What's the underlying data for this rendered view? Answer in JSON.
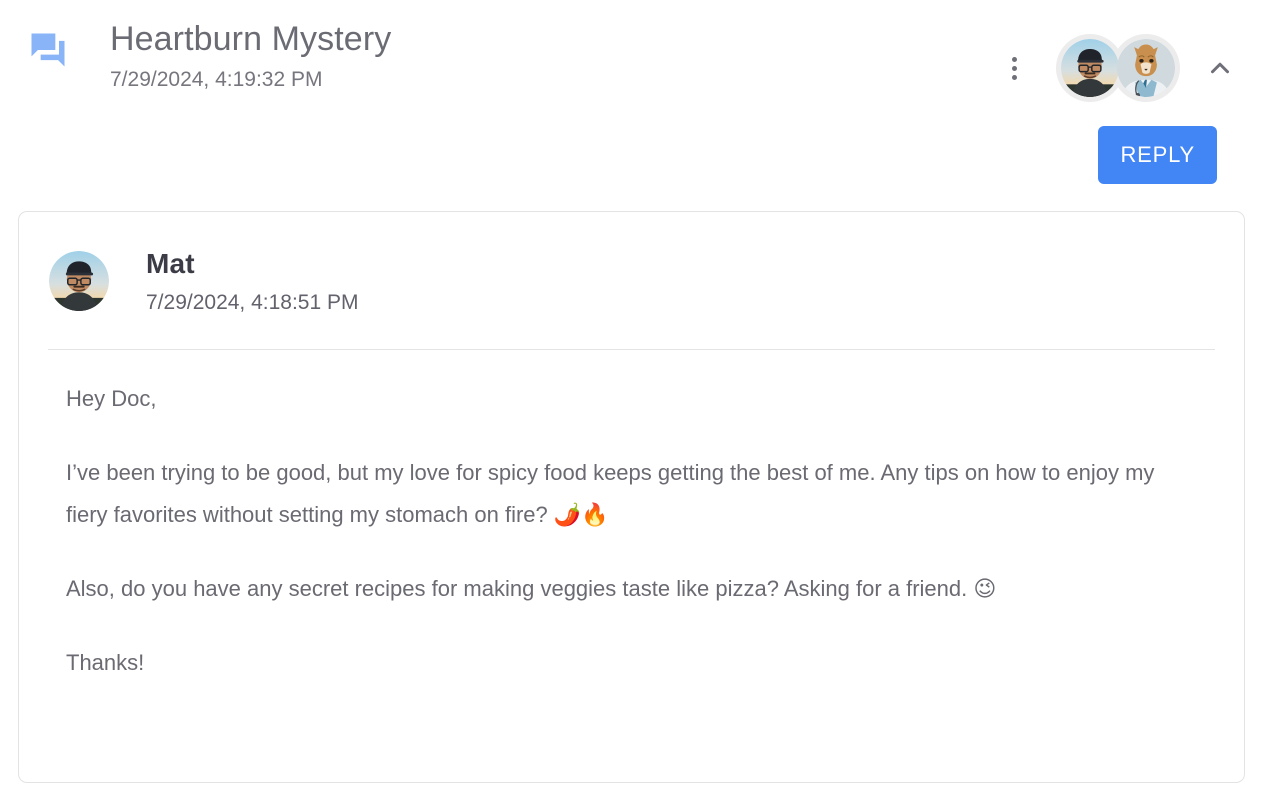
{
  "header": {
    "icon": "forum-icon",
    "icon_color": "#8ab4f8",
    "title": "Heartburn Mystery",
    "timestamp": "7/29/2024, 4:19:32 PM",
    "menu_icon": "more-vert-icon",
    "collapse_icon": "chevron-up-icon",
    "participants": [
      {
        "name": "Mat",
        "avatar": "person-cap-glasses-avatar"
      },
      {
        "name": "Doc",
        "avatar": "fox-doctor-avatar"
      }
    ]
  },
  "actions": {
    "reply_label": "REPLY",
    "reply_color": "#4285f4"
  },
  "message": {
    "author": "Mat",
    "avatar": "person-cap-glasses-avatar",
    "timestamp": "7/29/2024, 4:18:51 PM",
    "paragraphs": [
      "Hey Doc,",
      "I’ve been trying to be good, but my love for spicy food keeps getting the best of me. Any tips on how to enjoy my fiery favorites without setting my stomach on fire? 🌶️🔥",
      "Also, do you have any secret recipes for making veggies taste like pizza? Asking for a friend. 😉",
      "Thanks!"
    ]
  },
  "colors": {
    "title_text": "#6b6b74",
    "body_text": "#6a6a72",
    "author_text": "#3c3c46",
    "card_border": "#e3e3e5",
    "divider": "#e4e4e6"
  }
}
